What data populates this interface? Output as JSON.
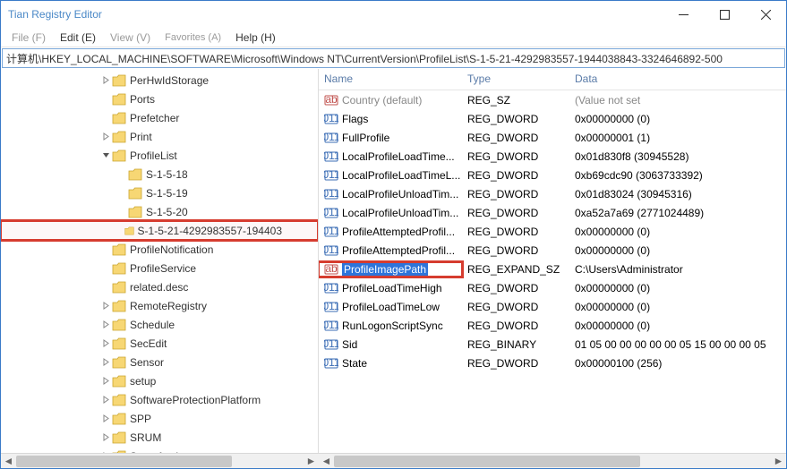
{
  "window": {
    "title": "Tian Registry Editor"
  },
  "menu": {
    "file": "File (F)",
    "edit": "Edit (E)",
    "view": "View (V)",
    "favorites": "Favorites (A)",
    "help": "Help (H)"
  },
  "address": "计算机\\HKEY_LOCAL_MACHINE\\SOFTWARE\\Microsoft\\Windows NT\\CurrentVersion\\ProfileList\\S-1-5-21-4292983557-1944038843-3324646892-500",
  "tree": [
    {
      "indent": 5,
      "exp": "closed",
      "label": "PerHwIdStorage"
    },
    {
      "indent": 5,
      "exp": "none",
      "label": "Ports"
    },
    {
      "indent": 5,
      "exp": "none",
      "label": "Prefetcher"
    },
    {
      "indent": 5,
      "exp": "closed",
      "label": "Print"
    },
    {
      "indent": 5,
      "exp": "open",
      "label": "ProfileList"
    },
    {
      "indent": 6,
      "exp": "none",
      "label": "S-1-5-18"
    },
    {
      "indent": 6,
      "exp": "none",
      "label": "S-1-5-19"
    },
    {
      "indent": 6,
      "exp": "none",
      "label": "S-1-5-20"
    },
    {
      "indent": 6,
      "exp": "none",
      "label": "S-1-5-21-4292983557-194403",
      "hi": true
    },
    {
      "indent": 5,
      "exp": "none",
      "label": "ProfileNotification"
    },
    {
      "indent": 5,
      "exp": "none",
      "label": "ProfileService"
    },
    {
      "indent": 5,
      "exp": "none",
      "label": "related.desc"
    },
    {
      "indent": 5,
      "exp": "closed",
      "label": "RemoteRegistry"
    },
    {
      "indent": 5,
      "exp": "closed",
      "label": "Schedule"
    },
    {
      "indent": 5,
      "exp": "closed",
      "label": "SecEdit"
    },
    {
      "indent": 5,
      "exp": "closed",
      "label": "Sensor"
    },
    {
      "indent": 5,
      "exp": "closed",
      "label": "setup"
    },
    {
      "indent": 5,
      "exp": "closed",
      "label": "SoftwareProtectionPlatform"
    },
    {
      "indent": 5,
      "exp": "closed",
      "label": "SPP"
    },
    {
      "indent": 5,
      "exp": "closed",
      "label": "SRUM"
    },
    {
      "indent": 5,
      "exp": "closed",
      "label": "Superfetch"
    }
  ],
  "columns": {
    "name": "Name",
    "type": "Type",
    "data": "Data"
  },
  "values": [
    {
      "icon": "str",
      "name": "Country (default)",
      "type": "REG_SZ",
      "data": "(Value not set",
      "default": true
    },
    {
      "icon": "bin",
      "name": "Flags",
      "type": "REG_DWORD",
      "data": "0x00000000 (0)"
    },
    {
      "icon": "bin",
      "name": "FullProfile",
      "type": "REG_DWORD",
      "data": "0x00000001 (1)"
    },
    {
      "icon": "bin",
      "name": "LocalProfileLoadTime...",
      "type": "REG_DWORD",
      "data": "0x01d830f8 (30945528)"
    },
    {
      "icon": "bin",
      "name": "LocalProfileLoadTimeL...",
      "type": "REG_DWORD",
      "data": "0xb69cdc90 (3063733392)"
    },
    {
      "icon": "bin",
      "name": "LocalProfileUnloadTim...",
      "type": "REG_DWORD",
      "data": "0x01d83024 (30945316)"
    },
    {
      "icon": "bin",
      "name": "LocalProfileUnloadTim...",
      "type": "REG_DWORD",
      "data": "0xa52a7a69 (2771024489)"
    },
    {
      "icon": "bin",
      "name": "ProfileAttemptedProfil...",
      "type": "REG_DWORD",
      "data": "0x00000000 (0)"
    },
    {
      "icon": "bin",
      "name": "ProfileAttemptedProfil...",
      "type": "REG_DWORD",
      "data": "0x00000000 (0)"
    },
    {
      "icon": "str",
      "name": "ProfileImagePath",
      "type": "REG_EXPAND_SZ",
      "data": "C:\\Users\\Administrator",
      "sel": true
    },
    {
      "icon": "bin",
      "name": "ProfileLoadTimeHigh",
      "type": "REG_DWORD",
      "data": "0x00000000 (0)"
    },
    {
      "icon": "bin",
      "name": "ProfileLoadTimeLow",
      "type": "REG_DWORD",
      "data": "0x00000000 (0)"
    },
    {
      "icon": "bin",
      "name": "RunLogonScriptSync",
      "type": "REG_DWORD",
      "data": "0x00000000 (0)"
    },
    {
      "icon": "bin",
      "name": "Sid",
      "type": "REG_BINARY",
      "data": "01 05 00 00 00 00 00 05 15 00 00 00 05"
    },
    {
      "icon": "bin",
      "name": "State",
      "type": "REG_DWORD",
      "data": "0x00000100 (256)"
    }
  ]
}
